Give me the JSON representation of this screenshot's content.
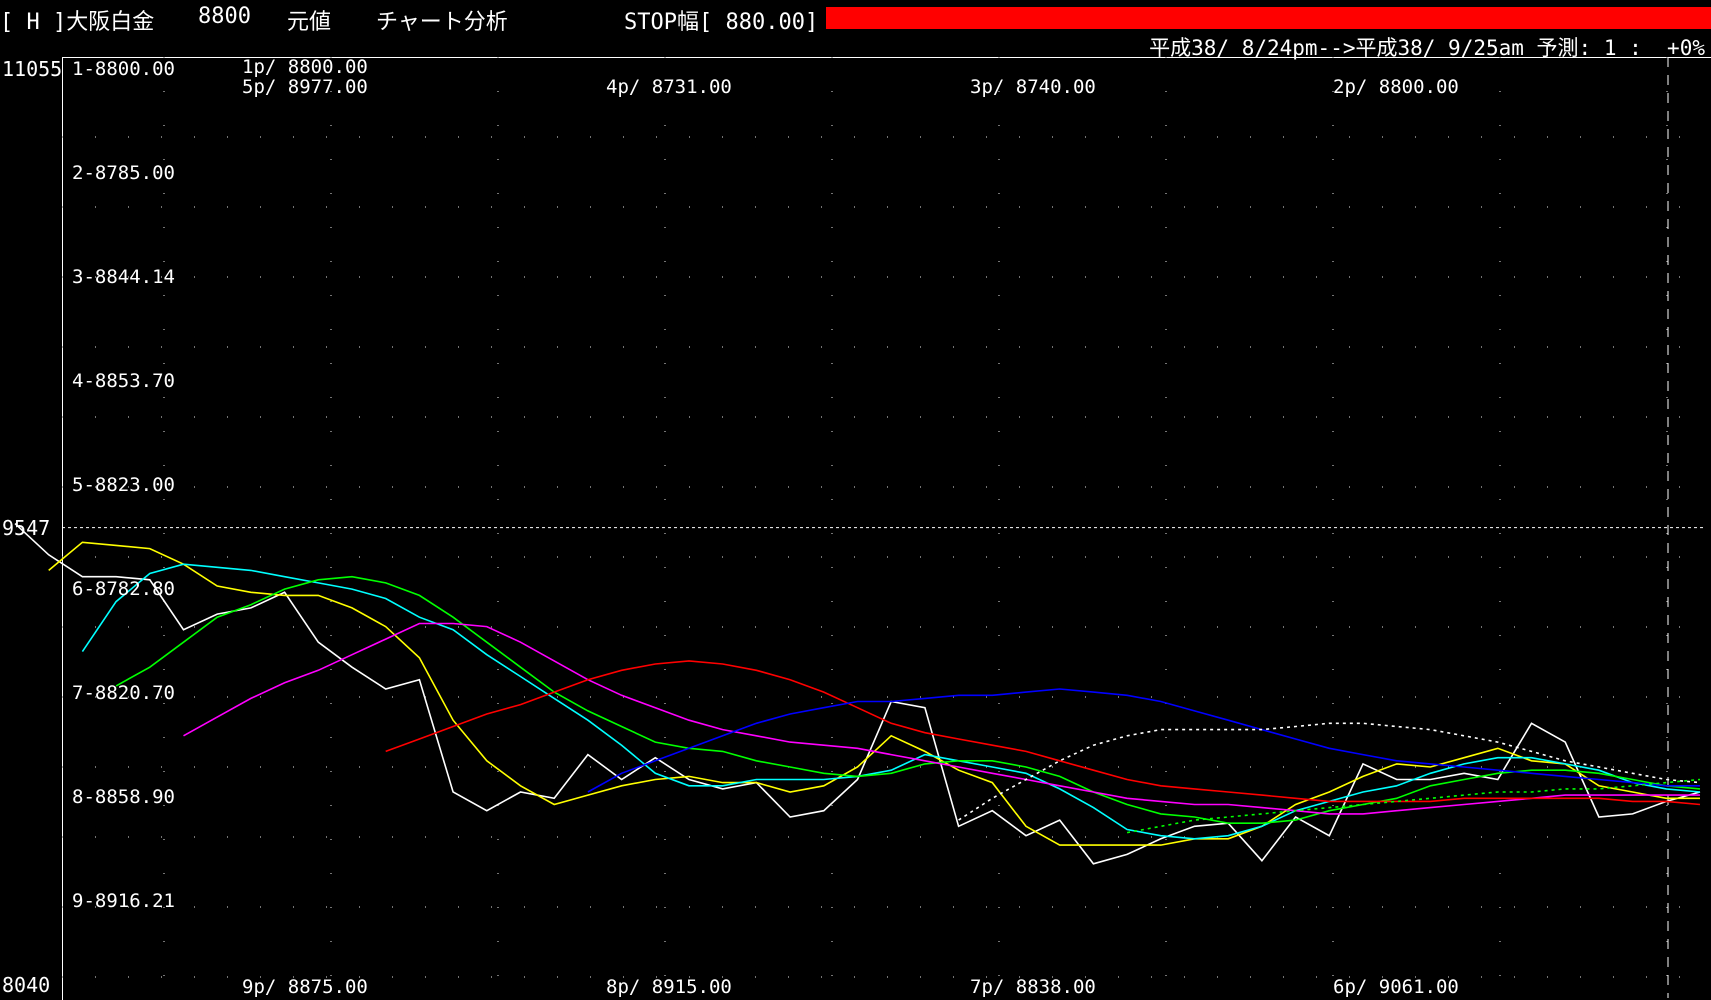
{
  "header": {
    "code": "[ H ]大阪白金",
    "value": "8800",
    "base": "元値",
    "mode": "チャート分析",
    "stop": "STOP幅[ 880.00]",
    "stop_bar_color": "#ff0000"
  },
  "date_range": "平成38/ 8/24pm-->平成38/ 9/25am 予測: 1 :  +0%",
  "chart_data": {
    "type": "line",
    "ylim": [
      8040,
      11055
    ],
    "y_ticks": [
      "11055",
      "9547",
      "8040"
    ],
    "reference_line": 9547,
    "row_labels": [
      "1-8800.00",
      "2-8785.00",
      "3-8844.14",
      "4-8853.70",
      "5-8823.00",
      "6-8782.80",
      "7-8820.70",
      "8-8858.90",
      "9-8916.21"
    ],
    "p_labels_top": [
      {
        "text": "1p/ 8800.00"
      },
      {
        "text": "5p/ 8977.00"
      },
      {
        "text": "4p/ 8731.00"
      },
      {
        "text": "3p/ 8740.00"
      },
      {
        "text": "2p/ 8800.00"
      }
    ],
    "p_labels_bottom": [
      {
        "text": "9p/ 8875.00"
      },
      {
        "text": "8p/ 8915.00"
      },
      {
        "text": "7p/ 8838.00"
      },
      {
        "text": "6p/ 9061.00"
      }
    ],
    "series": [
      {
        "color": "#ffffff",
        "dash": "",
        "values": [
          9560,
          9460,
          9390,
          9390,
          9380,
          9220,
          9270,
          9290,
          9340,
          9180,
          9100,
          9030,
          9060,
          8700,
          8640,
          8700,
          8680,
          8820,
          8740,
          8810,
          8740,
          8710,
          8730,
          8620,
          8640,
          8740,
          8990,
          8970,
          8590,
          8640,
          8560,
          8610,
          8470,
          8500,
          8550,
          8590,
          8600,
          8480,
          8620,
          8560,
          8790,
          8740,
          8740,
          8760,
          8740,
          8920,
          8860,
          8620,
          8630,
          8670,
          8700
        ]
      },
      {
        "color": "#ffff00",
        "dash": "",
        "values": [
          9410,
          9500,
          9490,
          9480,
          9430,
          9360,
          9340,
          9330,
          9330,
          9290,
          9230,
          9130,
          8930,
          8800,
          8720,
          8660,
          8690,
          8720,
          8740,
          8750,
          8730,
          8730,
          8700,
          8720,
          8780,
          8880,
          8830,
          8770,
          8730,
          8590,
          8530,
          8530,
          8530,
          8530,
          8550,
          8550,
          8590,
          8660,
          8700,
          8750,
          8790,
          8780,
          8810,
          8840,
          8800,
          8790,
          8720,
          8700,
          8680,
          8680
        ]
      },
      {
        "color": "#00ffff",
        "dash": "",
        "values": [
          9150,
          9310,
          9400,
          9430,
          9420,
          9410,
          9390,
          9370,
          9350,
          9320,
          9260,
          9220,
          9140,
          9070,
          9000,
          8930,
          8850,
          8760,
          8720,
          8720,
          8740,
          8740,
          8740,
          8750,
          8770,
          8820,
          8800,
          8780,
          8760,
          8710,
          8650,
          8580,
          8560,
          8550,
          8560,
          8590,
          8640,
          8670,
          8700,
          8720,
          8760,
          8790,
          8810,
          8810,
          8790,
          8770,
          8730,
          8710,
          8700
        ]
      },
      {
        "color": "#00ff00",
        "dash": "",
        "values": [
          9040,
          9100,
          9180,
          9260,
          9300,
          9350,
          9380,
          9390,
          9370,
          9330,
          9260,
          9180,
          9100,
          9020,
          8960,
          8910,
          8860,
          8840,
          8830,
          8800,
          8780,
          8760,
          8750,
          8760,
          8790,
          8800,
          8800,
          8780,
          8750,
          8700,
          8660,
          8630,
          8620,
          8600,
          8600,
          8610,
          8640,
          8660,
          8680,
          8720,
          8740,
          8760,
          8770,
          8770,
          8760,
          8740,
          8720,
          8710
        ]
      },
      {
        "color": "#ff00ff",
        "dash": "",
        "values": [
          8880,
          8940,
          9000,
          9050,
          9090,
          9140,
          9190,
          9240,
          9240,
          9230,
          9180,
          9120,
          9060,
          9010,
          8970,
          8930,
          8900,
          8880,
          8860,
          8850,
          8840,
          8820,
          8800,
          8780,
          8760,
          8740,
          8720,
          8700,
          8680,
          8670,
          8660,
          8660,
          8650,
          8640,
          8630,
          8630,
          8640,
          8650,
          8660,
          8670,
          8680,
          8690,
          8690,
          8690,
          8690,
          8690
        ]
      },
      {
        "color": "#ff0000",
        "dash": "",
        "values": [
          8830,
          8870,
          8910,
          8950,
          8980,
          9020,
          9060,
          9090,
          9110,
          9120,
          9110,
          9090,
          9060,
          9020,
          8970,
          8920,
          8890,
          8870,
          8850,
          8830,
          8800,
          8770,
          8740,
          8720,
          8710,
          8700,
          8690,
          8680,
          8670,
          8670,
          8670,
          8670,
          8680,
          8680,
          8680,
          8680,
          8680,
          8670,
          8670,
          8660
        ]
      },
      {
        "color": "#0000ff",
        "dash": "",
        "values": [
          8700,
          8760,
          8800,
          8840,
          8880,
          8920,
          8950,
          8970,
          8990,
          8990,
          9000,
          9010,
          9010,
          9020,
          9030,
          9020,
          9010,
          8990,
          8960,
          8930,
          8900,
          8870,
          8840,
          8820,
          8800,
          8790,
          8780,
          8770,
          8760,
          8750,
          8740,
          8730,
          8720,
          8720
        ]
      },
      {
        "color": "#ffffff",
        "dash": "3,4",
        "values": [
          8610,
          8680,
          8740,
          8800,
          8850,
          8880,
          8900,
          8900,
          8900,
          8900,
          8910,
          8920,
          8920,
          8910,
          8900,
          8880,
          8860,
          8830,
          8800,
          8780,
          8760,
          8740,
          8730
        ]
      },
      {
        "color": "#00ff00",
        "dash": "3,4",
        "values": [
          8570,
          8590,
          8610,
          8620,
          8630,
          8640,
          8650,
          8660,
          8670,
          8680,
          8690,
          8700,
          8700,
          8710,
          8710,
          8720,
          8730,
          8740
        ]
      }
    ]
  }
}
